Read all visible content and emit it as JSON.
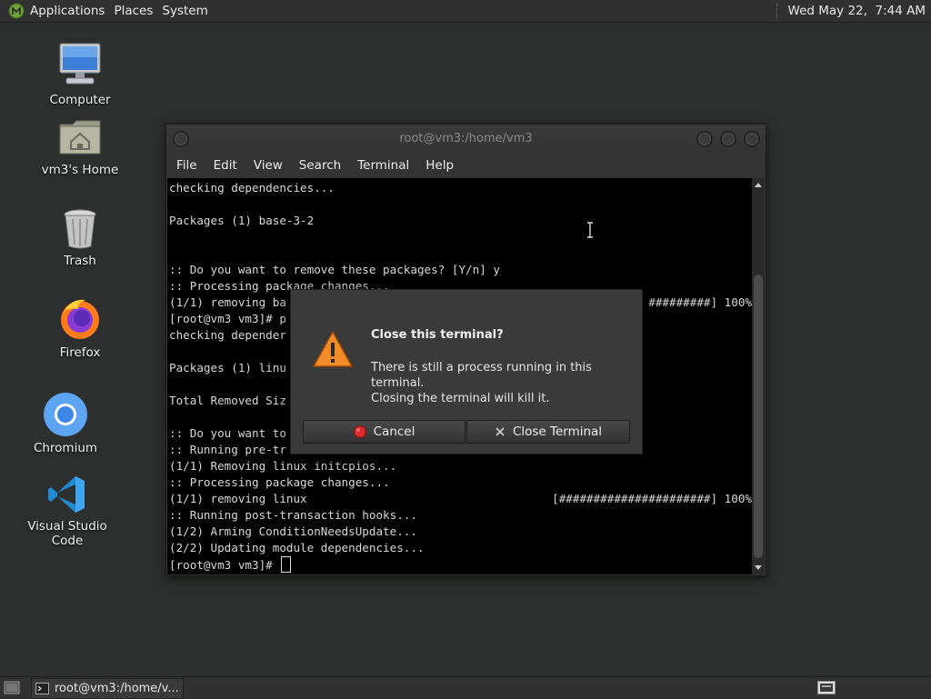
{
  "top_panel": {
    "menus": [
      "Applications",
      "Places",
      "System"
    ],
    "clock": "Wed May 22,  7:44 AM"
  },
  "desktop_icons": [
    {
      "label": "Computer",
      "icon": "computer-icon"
    },
    {
      "label": "vm3's Home",
      "icon": "home-folder-icon"
    },
    {
      "label": "Trash",
      "icon": "trash-icon"
    },
    {
      "label": "Firefox",
      "icon": "firefox-icon"
    },
    {
      "label": "Chromium",
      "icon": "chromium-icon"
    },
    {
      "label": "Visual Studio Code",
      "icon": "vscode-icon"
    }
  ],
  "terminal": {
    "title": "root@vm3:/home/vm3",
    "menus": [
      "File",
      "Edit",
      "View",
      "Search",
      "Terminal",
      "Help"
    ],
    "lines": [
      "checking dependencies...",
      "",
      "Packages (1) base-3-2",
      "",
      "",
      ":: Do you want to remove these packages? [Y/n] y",
      ":: Processing package changes...",
      "(1/1) removing ba",
      "[root@vm3 vm3]# p",
      "checking depender",
      "",
      "Packages (1) linu",
      "",
      "Total Removed Siz",
      "",
      ":: Do you want to",
      ":: Running pre-tr",
      "(1/1) Removing linux initcpios...",
      ":: Processing package changes...",
      "(1/1) removing linux",
      ":: Running post-transaction hooks...",
      "(1/2) Arming ConditionNeedsUpdate...",
      "(2/2) Updating module dependencies...",
      "[root@vm3 vm3]# "
    ],
    "progress_line_7": "#########] 100%",
    "progress_line_19": "[######################] 100%"
  },
  "dialog": {
    "title": "Close this terminal?",
    "message_line1": "There is still a process running in this terminal.",
    "message_line2": "Closing the terminal will kill it.",
    "cancel_label": "Cancel",
    "close_label": "Close Terminal"
  },
  "taskbar": {
    "window_label": "root@vm3:/home/v..."
  },
  "colors": {
    "desktop_bg": "#2d2f2e",
    "panel_bg": "#313131",
    "warning": "#f28c28",
    "cancel_red": "#d92b2b"
  }
}
